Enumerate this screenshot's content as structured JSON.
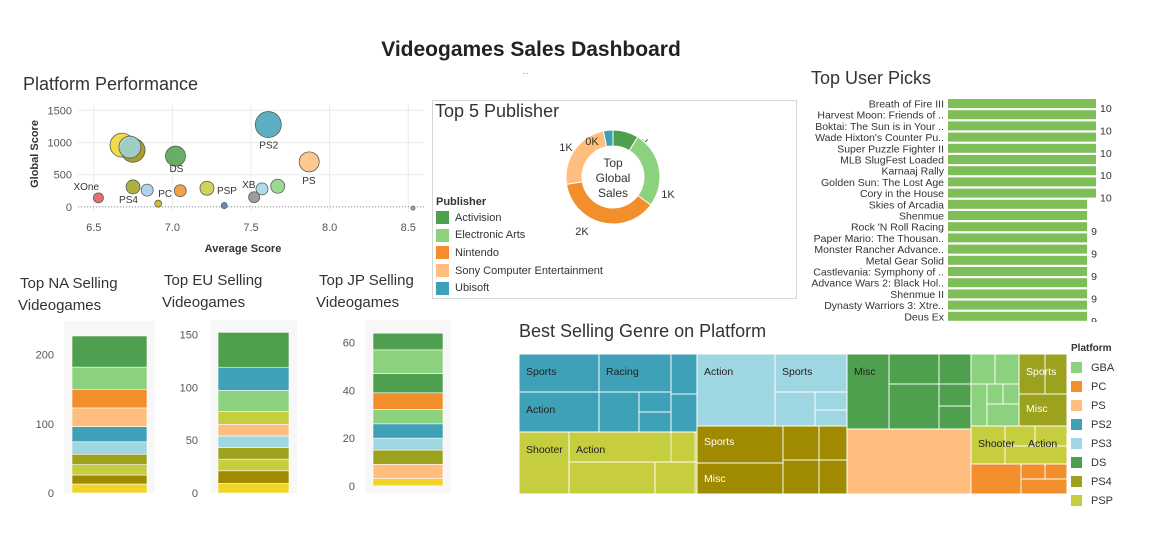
{
  "dashboard": {
    "title": "Videogames Sales Dashboard",
    "handle": "··"
  },
  "colors": {
    "Activision": "#4e9f4e",
    "Electronic Arts": "#8cd17d",
    "Nintendo": "#f28e2b",
    "Sony Computer Entertainment": "#ffbe7d",
    "Ubisoft": "#3fa1b7",
    "GBA": "#8cd17d",
    "PC": "#f28e2b",
    "PS": "#ffbe7d",
    "PS2": "#3fa1b7",
    "PS3": "#9ed6e2",
    "DS": "#4e9f4e",
    "PS4": "#9da21e",
    "PSP": "#c6cd3e",
    "olive_dark": "#a08b00",
    "yellow": "#f0d428",
    "bar_green": "#7dbf56"
  },
  "charts": {
    "platform_performance": {
      "section_title": "Platform Performance",
      "chart_data": {
        "type": "scatter",
        "xlabel": "Average Score",
        "ylabel": "Global Score",
        "xlim": [
          6.4,
          8.6
        ],
        "ylim": [
          -80,
          1600
        ],
        "xticks": [
          "6.5",
          "7.0",
          "7.5",
          "8.0",
          "8.5"
        ],
        "yticks": [
          "0",
          "500",
          "1000",
          "1500"
        ],
        "points": [
          {
            "x": 6.68,
            "y": 960,
            "r": 12,
            "color": "#f0d428",
            "label": ""
          },
          {
            "x": 6.75,
            "y": 880,
            "r": 12,
            "color": "#a08b00",
            "label": ""
          },
          {
            "x": 6.73,
            "y": 930,
            "r": 11,
            "color": "#9ed6e2",
            "label": ""
          },
          {
            "x": 6.75,
            "y": 310,
            "r": 7,
            "color": "#9da21e",
            "label": "PS4"
          },
          {
            "x": 6.53,
            "y": 140,
            "r": 5,
            "color": "#e15759",
            "label": "XOne"
          },
          {
            "x": 6.84,
            "y": 260,
            "r": 6,
            "color": "#a0cbe8",
            "label": ""
          },
          {
            "x": 6.91,
            "y": 50,
            "r": 3.5,
            "color": "#c9b200",
            "label": ""
          },
          {
            "x": 7.02,
            "y": 790,
            "r": 10,
            "color": "#4e9f4e",
            "label": "DS"
          },
          {
            "x": 7.05,
            "y": 250,
            "r": 6,
            "color": "#f28e2b",
            "label": "PC"
          },
          {
            "x": 7.22,
            "y": 290,
            "r": 7,
            "color": "#c6cd3e",
            "label": "PSP"
          },
          {
            "x": 7.33,
            "y": 20,
            "r": 3,
            "color": "#4e79a7",
            "label": ""
          },
          {
            "x": 7.52,
            "y": 150,
            "r": 5.5,
            "color": "#8c8c8c",
            "label": "XB"
          },
          {
            "x": 7.57,
            "y": 280,
            "r": 6,
            "color": "#9ed6e2",
            "label": ""
          },
          {
            "x": 7.61,
            "y": 1280,
            "r": 13,
            "color": "#3fa1b7",
            "label": "PS2"
          },
          {
            "x": 7.67,
            "y": 320,
            "r": 7,
            "color": "#8cd17d",
            "label": ""
          },
          {
            "x": 7.87,
            "y": 700,
            "r": 10,
            "color": "#ffbe7d",
            "label": "PS"
          },
          {
            "x": 8.53,
            "y": -20,
            "r": 2,
            "color": "#9a9a9a",
            "label": ""
          }
        ]
      }
    },
    "top_publisher": {
      "section_title": "Top 5 Publisher",
      "chart_data": {
        "type": "pie",
        "center_label": [
          "Top",
          "Global",
          "Sales"
        ],
        "legend_title": "Publisher",
        "slices": [
          {
            "name": "Activision",
            "value": 8,
            "label": "1K"
          },
          {
            "name": "Electronic Arts",
            "value": 24,
            "label": "1K"
          },
          {
            "name": "Nintendo",
            "value": 34,
            "label": "2K"
          },
          {
            "name": "Sony Computer Entertainment",
            "value": 22,
            "label": "1K"
          },
          {
            "name": "Ubisoft",
            "value": 3,
            "label": "0K"
          }
        ]
      }
    },
    "top_user_picks": {
      "section_title": "Top User Picks",
      "chart_data": {
        "type": "bar",
        "categories": [
          "Breath of Fire III",
          "Harvest Moon: Friends of ..",
          "Boktai: The Sun is in Your ..",
          "Wade Hixton's Counter Pu..",
          "Super Puzzle Fighter II",
          "MLB SlugFest Loaded",
          "Karnaaj Rally",
          "Golden Sun: The Lost Age",
          "Cory in the House",
          "Skies of Arcadia",
          "Shenmue",
          "Rock 'N Roll Racing",
          "Paper Mario: The Thousan..",
          "Monster Rancher Advance..",
          "Metal Gear Solid",
          "Castlevania: Symphony of ..",
          "Advance Wars 2: Black Hol..",
          "Shenmue II",
          "Dynasty Warriors 3: Xtre..",
          "Deus Ex"
        ],
        "values": [
          10,
          10,
          10,
          10,
          10,
          10,
          10,
          10,
          10,
          9.4,
          9.4,
          9.4,
          9.4,
          9.4,
          9.4,
          9.4,
          9.4,
          9.4,
          9.4,
          9.4
        ],
        "labels": [
          "10",
          "",
          "10",
          "",
          "10",
          "",
          "10",
          "",
          "10",
          "",
          "",
          "9",
          "",
          "9",
          "",
          "9",
          "",
          "9",
          "",
          "9"
        ],
        "xlim": [
          0,
          10
        ]
      }
    },
    "top_na": {
      "section_title": [
        "Top NA Selling",
        "Videogames"
      ],
      "chart_data": {
        "type": "bar",
        "yticks": [
          "0",
          "100",
          "200"
        ],
        "ylim": [
          0,
          240
        ],
        "segments": [
          {
            "value": 13,
            "color": "#f0d428"
          },
          {
            "value": 13,
            "color": "#a08b00"
          },
          {
            "value": 15,
            "color": "#c6cd3e"
          },
          {
            "value": 15,
            "color": "#9da21e"
          },
          {
            "value": 18,
            "color": "#9ed6e2"
          },
          {
            "value": 22,
            "color": "#3fa1b7"
          },
          {
            "value": 27,
            "color": "#ffbe7d"
          },
          {
            "value": 27,
            "color": "#f28e2b"
          },
          {
            "value": 32,
            "color": "#8cd17d"
          },
          {
            "value": 45,
            "color": "#4e9f4e"
          }
        ]
      }
    },
    "top_eu": {
      "section_title": [
        "Top EU Selling",
        "Videogames"
      ],
      "chart_data": {
        "type": "bar",
        "yticks": [
          "0",
          "50",
          "100",
          "150"
        ],
        "ylim": [
          0,
          158
        ],
        "segments": [
          {
            "value": 9,
            "color": "#f0d428"
          },
          {
            "value": 12,
            "color": "#a08b00"
          },
          {
            "value": 11,
            "color": "#c6cd3e"
          },
          {
            "value": 11,
            "color": "#9da21e"
          },
          {
            "value": 11,
            "color": "#9ed6e2"
          },
          {
            "value": 11,
            "color": "#ffbe7d"
          },
          {
            "value": 12,
            "color": "#c6cd3e"
          },
          {
            "value": 20,
            "color": "#8cd17d"
          },
          {
            "value": 22,
            "color": "#3fa1b7"
          },
          {
            "value": 33,
            "color": "#4e9f4e"
          }
        ]
      }
    },
    "top_jp": {
      "section_title": [
        "Top JP Selling",
        "Videogames"
      ],
      "chart_data": {
        "type": "bar",
        "yticks": [
          "0",
          "20",
          "40",
          "60"
        ],
        "ylim": [
          -3,
          67
        ],
        "segments": [
          {
            "value": 3,
            "color": "#f0d428"
          },
          {
            "value": 6,
            "color": "#ffbe7d"
          },
          {
            "value": 6,
            "color": "#9da21e"
          },
          {
            "value": 5,
            "color": "#9ed6e2"
          },
          {
            "value": 6,
            "color": "#3fa1b7"
          },
          {
            "value": 6,
            "color": "#8cd17d"
          },
          {
            "value": 7,
            "color": "#f28e2b"
          },
          {
            "value": 8,
            "color": "#4e9f4e"
          },
          {
            "value": 10,
            "color": "#8cd17d"
          },
          {
            "value": 7,
            "color": "#4e9f4e"
          }
        ]
      }
    },
    "best_genre": {
      "section_title": "Best Selling Genre on Platform",
      "legend_title": "Platform",
      "legend": [
        "GBA",
        "PC",
        "PS",
        "PS2",
        "PS3",
        "DS",
        "PS4",
        "PSP"
      ],
      "chart_data": {
        "type": "heatmap",
        "groups": [
          {
            "platform": "PS2",
            "cells": [
              {
                "label": "Sports",
                "x": 0,
                "y": 0,
                "w": 80,
                "h": 38
              },
              {
                "label": "Racing",
                "x": 80,
                "y": 0,
                "w": 72,
                "h": 38
              },
              {
                "label": "Action",
                "x": 0,
                "y": 38,
                "w": 80,
                "h": 40
              },
              {
                "label": "",
                "x": 80,
                "y": 38,
                "w": 40,
                "h": 40
              }
            ]
          },
          {
            "platform": "PS3",
            "cells": [
              {
                "label": "Action",
                "x": 0,
                "y": 0,
                "w": 78,
                "h": 38
              },
              {
                "label": "Sports",
                "x": 78,
                "y": 0,
                "w": 70,
                "h": 38
              }
            ]
          },
          {
            "platform": "DS",
            "cells": [
              {
                "label": "Misc",
                "x": 0,
                "y": 0,
                "w": 42,
                "h": 75
              }
            ]
          },
          {
            "platform": "PS",
            "cells": [
              {
                "label": "",
                "x": 0,
                "y": 0,
                "w": 124,
                "h": 60
              }
            ]
          },
          {
            "platform": "PSP",
            "cells": [
              {
                "label": "Shooter",
                "x": 0,
                "y": 0,
                "w": 50,
                "h": 30
              },
              {
                "label": "Action",
                "x": 50,
                "y": 0,
                "w": 126,
                "h": 30
              }
            ]
          },
          {
            "platform": "PS4",
            "cells": [
              {
                "label": "Sports",
                "x": 0,
                "y": 0,
                "w": 86,
                "h": 37
              },
              {
                "label": "Misc",
                "x": 0,
                "y": 37,
                "w": 86,
                "h": 30
              }
            ]
          },
          {
            "platform": "GBA",
            "cells": [
              {
                "label": "",
                "x": 0,
                "y": 0,
                "w": 48,
                "h": 70
              }
            ]
          },
          {
            "platform": "PC",
            "cells": [
              {
                "label": "",
                "x": 0,
                "y": 0,
                "w": 40,
                "h": 30
              }
            ]
          }
        ]
      }
    }
  }
}
